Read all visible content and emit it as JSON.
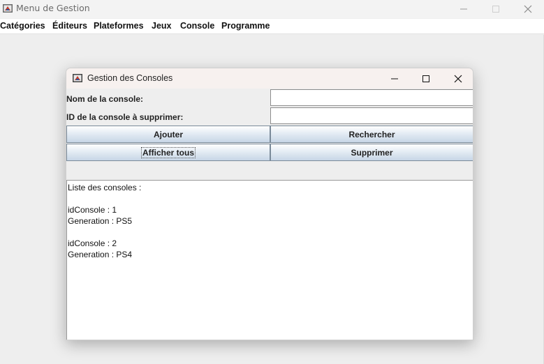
{
  "main_window": {
    "title": "Menu de Gestion",
    "menu": [
      "Catégories",
      "Éditeurs",
      "Plateformes",
      "Jeux",
      "Console",
      "Programme"
    ]
  },
  "dialog": {
    "title": "Gestion des Consoles",
    "fields": {
      "name_label": "Nom de la console:",
      "name_value": "",
      "delete_id_label": "ID de la console à supprimer:",
      "delete_id_value": ""
    },
    "buttons": {
      "add": "Ajouter",
      "search": "Rechercher",
      "show_all": "Afficher tous",
      "delete": "Supprimer"
    },
    "output_text": "Liste des consoles :\n\nidConsole : 1\nGeneration : PS5\n\nidConsole : 2\nGeneration : PS4"
  },
  "icons": {
    "app": "java-app-icon",
    "minimize": "minimize-icon",
    "maximize": "maximize-icon",
    "close": "close-icon"
  }
}
